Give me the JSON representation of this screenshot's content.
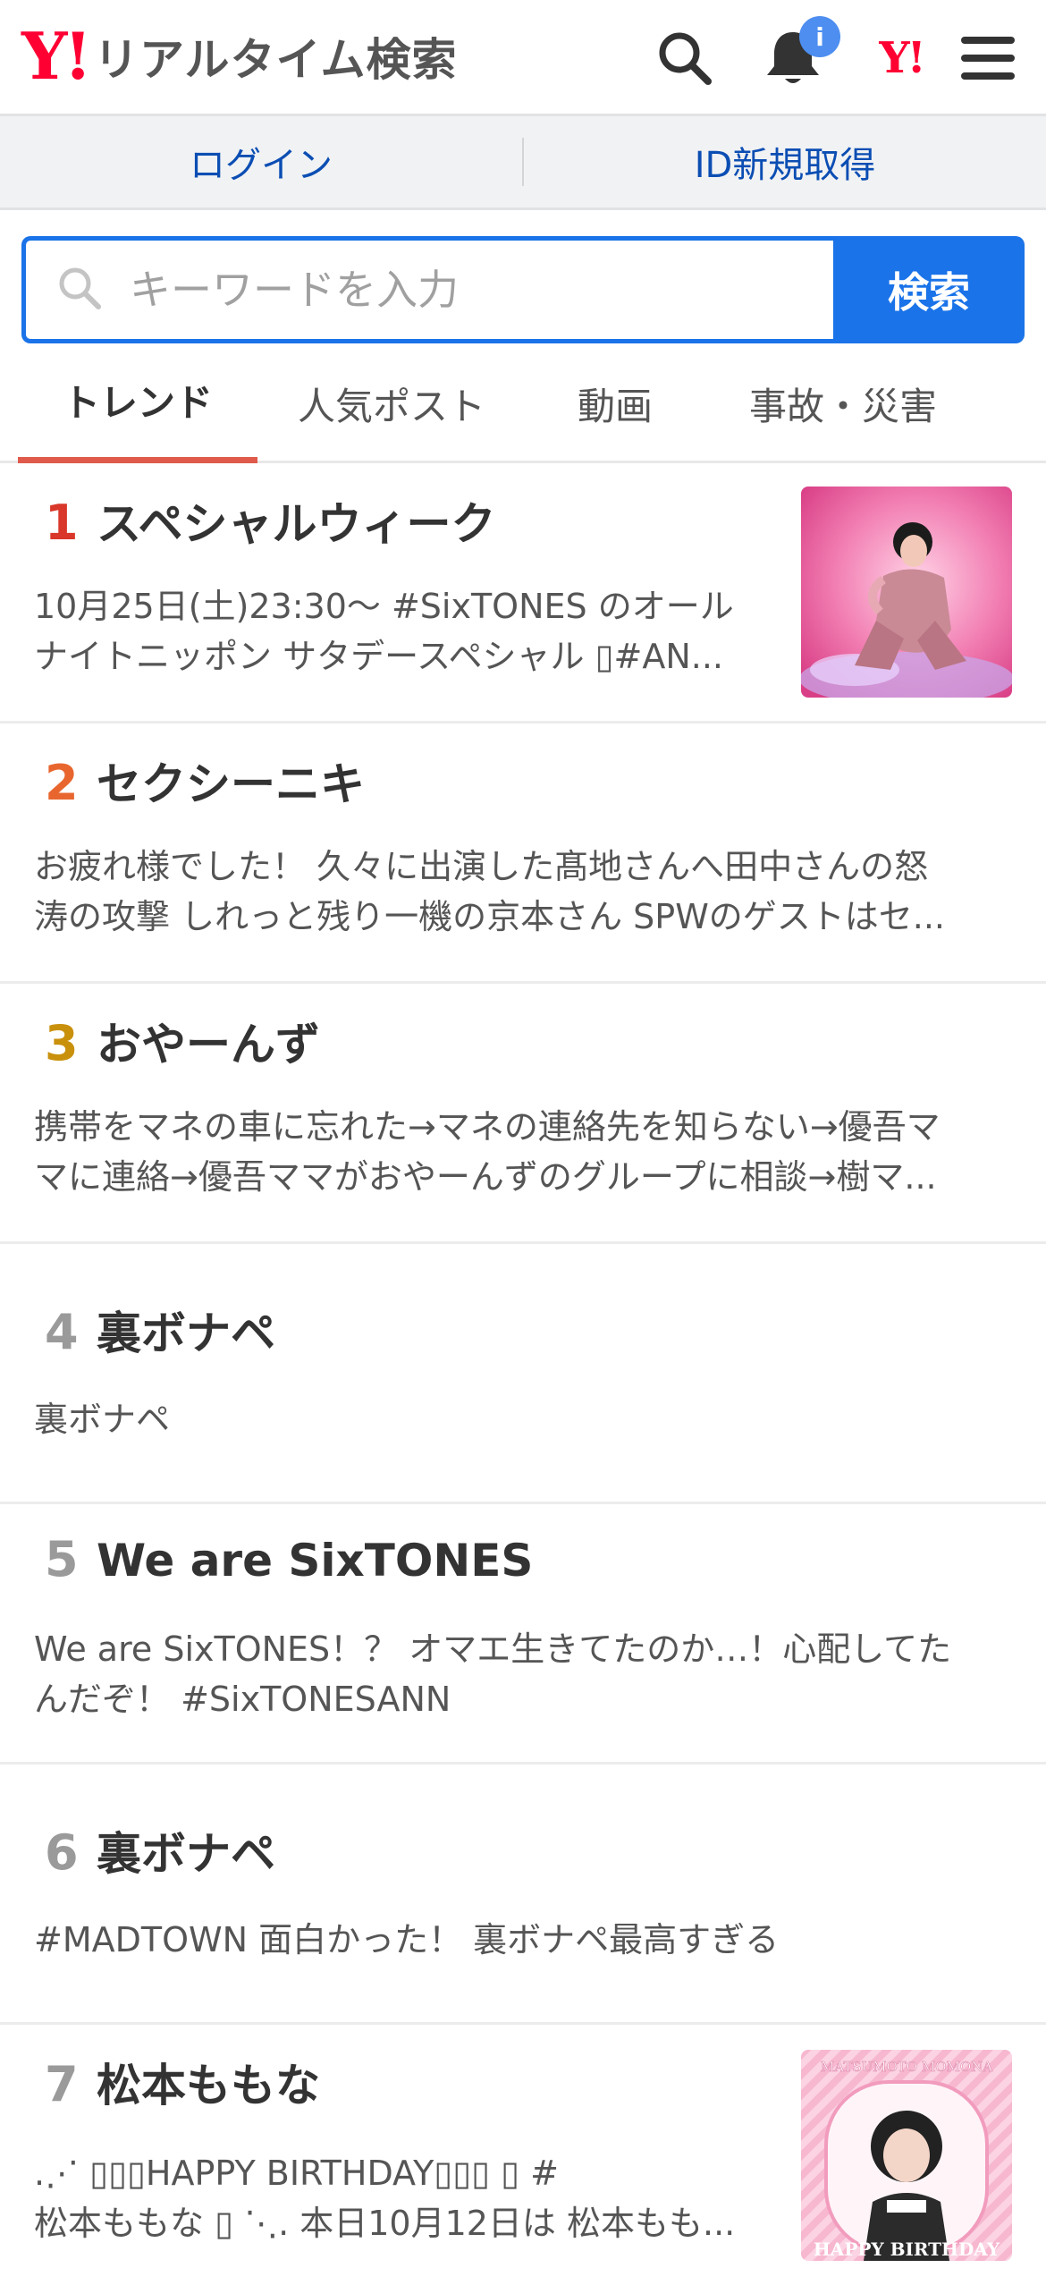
{
  "header": {
    "logo_mark": "Y!",
    "logo_text": "リアルタイム検索",
    "notification_badge": "i",
    "yahoo_mark": "Y!"
  },
  "auth": {
    "login_label": "ログイン",
    "register_label": "ID新規取得"
  },
  "search": {
    "placeholder": "キーワードを入力",
    "button_label": "検索"
  },
  "tabs": [
    {
      "label": "トレンド",
      "active": true
    },
    {
      "label": "人気ポスト",
      "active": false
    },
    {
      "label": "動画",
      "active": false
    },
    {
      "label": "事故・災害",
      "active": false
    }
  ],
  "colors": {
    "accent_blue": "#1a73e8",
    "link_blue": "#0b4eb3",
    "brand_red": "#ff0033",
    "rank1": "#d8372a",
    "rank2": "#e8662e",
    "rank3": "#c9900c",
    "rank_other": "#9a9a9a"
  },
  "trends": [
    {
      "rank": "1",
      "title": "スペシャルウィーク",
      "desc_line1": "10月25日(土)23:30〜 #SixTONES のオール",
      "desc_line2": "ナイトニッポン サタデースペシャル ▯#AN...",
      "has_thumb": true
    },
    {
      "rank": "2",
      "title": "セクシーニキ",
      "desc_line1": "お疲れ様でした！ 久々に出演した髙地さんへ田中さんの怒",
      "desc_line2": "涛の攻撃 しれっと残り一機の京本さん SPWのゲストはセ...",
      "has_thumb": false
    },
    {
      "rank": "3",
      "title": "おやーんず",
      "desc_line1": "携帯をマネの車に忘れた→マネの連絡先を知らない→優吾マ",
      "desc_line2": "マに連絡→優吾ママがおやーんずのグループに相談→樹マ...",
      "has_thumb": false
    },
    {
      "rank": "4",
      "title": "裏ボナペ",
      "desc_line1": "裏ボナペ",
      "desc_line2": "",
      "has_thumb": false
    },
    {
      "rank": "5",
      "title": "We are SixTONES",
      "desc_line1": "We are SixTONES！？ オマエ生きてたのか…！心配してた",
      "desc_line2": "んだぞ！ #SixTONESANN",
      "has_thumb": false
    },
    {
      "rank": "6",
      "title": "裏ボナペ",
      "desc_line1": "#MADTOWN 面白かった！ 裏ボナペ最高すぎる",
      "desc_line2": "",
      "has_thumb": false
    },
    {
      "rank": "7",
      "title": "松本ももな",
      "desc_line1": ".⋰ ▯▯▯HAPPY BIRTHDAY▯▯▯ ▯ #",
      "desc_line2": "松本ももな ▯ ⋱. 本日10月12日は 松本もも...",
      "has_thumb": true,
      "thumb_caption_top": "MATSUMOTO MOMONA",
      "thumb_caption_bottom": "HAPPY BIRTHDAY"
    }
  ]
}
